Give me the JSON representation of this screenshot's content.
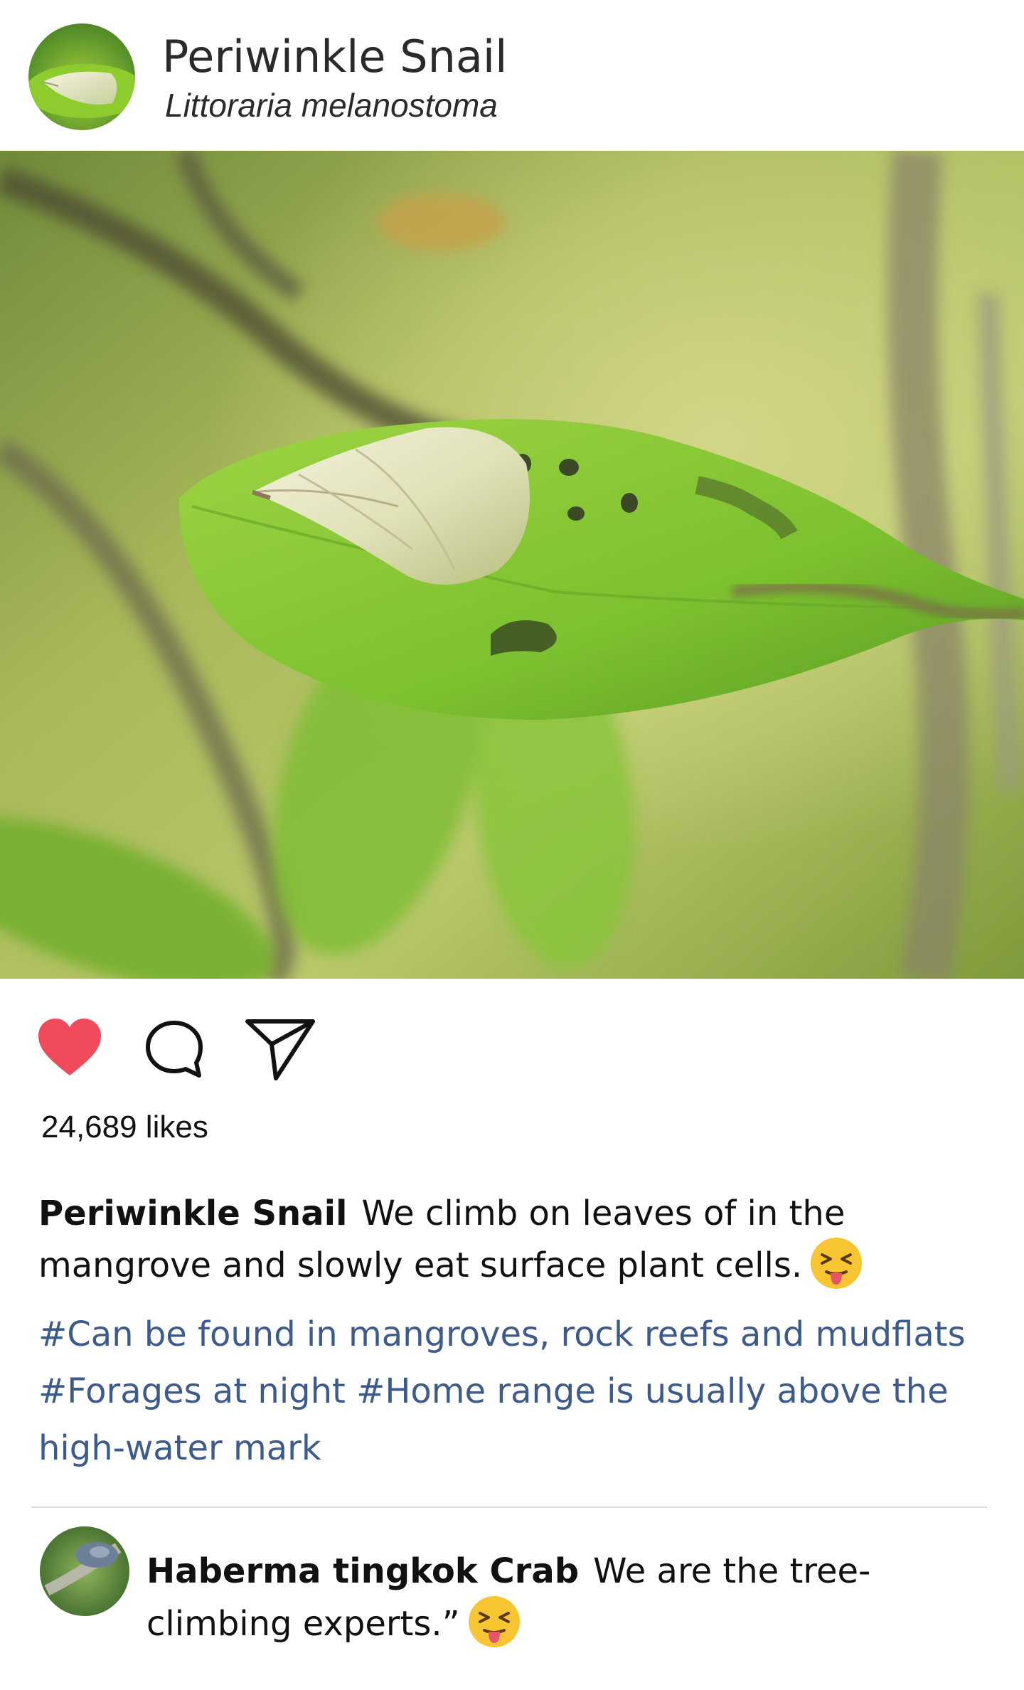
{
  "profile": {
    "name": "Periwinkle Snail",
    "subtitle": "Littoraria melanostoma"
  },
  "post": {
    "image_subject": "snail-on-leaf-photo",
    "likes": "24,689 likes",
    "liked": true,
    "caption_user": "Periwinkle Snail",
    "caption_text": "We climb on leaves of in the mangrove and slowly eat surface plant cells.",
    "hashtags": "#Can be found in mangroves, rock reefs and mudflats #Forages at night #Home range is usually above the high-water mark"
  },
  "actions": {
    "like_icon": "heart-icon",
    "comment_icon": "speech-bubble-icon",
    "share_icon": "paper-plane-icon"
  },
  "comment": {
    "user": "Haberma tingkok Crab",
    "text": "We are the tree-climbing experts.”"
  },
  "colors": {
    "like_red": "#ef4b5b",
    "hashtag_blue": "#3d5a8c",
    "divider": "#d9d9d9"
  }
}
